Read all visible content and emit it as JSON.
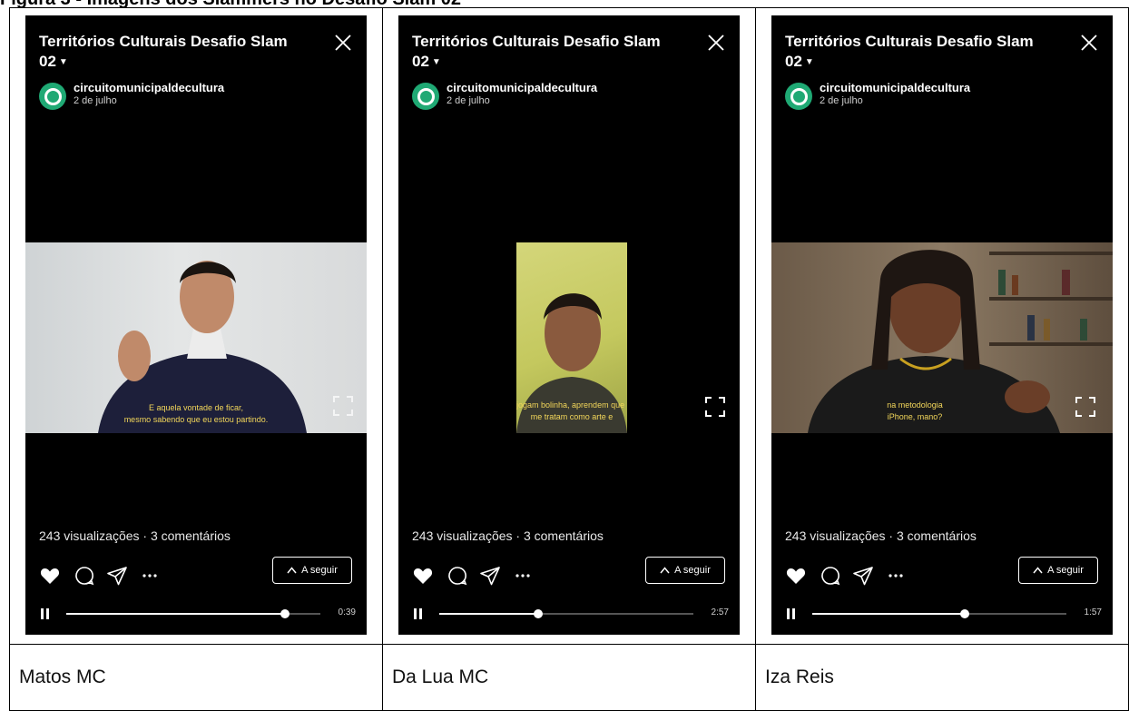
{
  "figure_title": "Figura 3 - Imagens dos Slammers no Desafio Slam 02",
  "colors": {
    "background": "#000000",
    "avatar": "#1fa974",
    "subtitle": "#f2d65a"
  },
  "panels": [
    {
      "caption": "Matos MC",
      "title": "Territórios Culturais  Desafio Slam 02",
      "account": "circuitomunicipaldecultura",
      "date": "2 de julho",
      "stats": "243 visualizações · 3 comentários",
      "next_label": "A seguir",
      "time": "0:39",
      "progress": 0.86,
      "subtitle_lines": [
        "E aquela vontade de ficar,",
        "mesmo sabendo que eu estou partindo."
      ],
      "icons": [
        "close-icon",
        "heart-icon",
        "comment-icon",
        "share-icon",
        "more-icon",
        "chevron-up-icon",
        "pause-icon",
        "fullscreen-icon"
      ]
    },
    {
      "caption": "Da Lua MC",
      "title": "Territórios Culturais  Desafio Slam 02",
      "account": "circuitomunicipaldecultura",
      "date": "2 de julho",
      "stats": "243 visualizações · 3 comentários",
      "next_label": "A seguir",
      "time": "2:57",
      "progress": 0.39,
      "subtitle_lines": [
        "jogam bolinha, aprendem que é",
        "me tratam como arte e"
      ],
      "icons": [
        "close-icon",
        "heart-icon",
        "comment-icon",
        "share-icon",
        "more-icon",
        "chevron-up-icon",
        "pause-icon",
        "fullscreen-icon"
      ]
    },
    {
      "caption": "Iza Reis",
      "title": "Territórios Culturais  Desafio Slam 02",
      "account": "circuitomunicipaldecultura",
      "date": "2 de julho",
      "stats": "243 visualizações · 3 comentários",
      "next_label": "A seguir",
      "time": "1:57",
      "progress": 0.6,
      "subtitle_lines": [
        "na metodologia",
        "iPhone, mano?"
      ],
      "icons": [
        "close-icon",
        "heart-icon",
        "comment-icon",
        "share-icon",
        "more-icon",
        "chevron-up-icon",
        "pause-icon",
        "fullscreen-icon"
      ]
    }
  ]
}
